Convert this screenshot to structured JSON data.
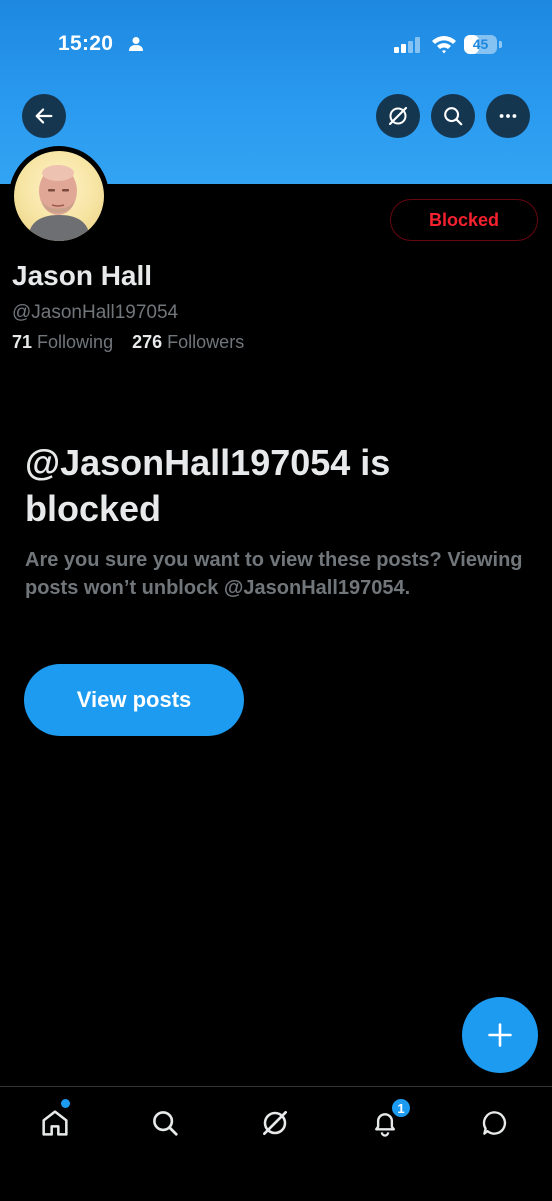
{
  "status_bar": {
    "time": "15:20",
    "battery": "45",
    "battery_level": 0.45
  },
  "header": {
    "back_icon": "arrow-left-icon",
    "grok_icon": "grok-icon",
    "search_icon": "search-icon",
    "more_icon": "more-horizontal-icon"
  },
  "profile": {
    "name": "Jason Hall",
    "handle": "@JasonHall197054",
    "following_count": "71",
    "following_label": "Following",
    "followers_count": "276",
    "followers_label": "Followers",
    "blocked_button": "Blocked"
  },
  "blocked_notice": {
    "title": "@JasonHall197054 is blocked",
    "message": "Are you sure you want to view these posts? Viewing posts won’t unblock @JasonHall197054.",
    "button": "View posts"
  },
  "fab": {
    "icon": "plus-icon"
  },
  "tabbar": {
    "items": [
      "home-icon",
      "search-icon",
      "grok-icon",
      "notifications-icon",
      "messages-icon"
    ],
    "notification_count": "1"
  },
  "colors": {
    "accent": "#1d9bf0",
    "blocked_red": "#f4212e",
    "background": "#000000",
    "secondary_text": "#71767b"
  }
}
